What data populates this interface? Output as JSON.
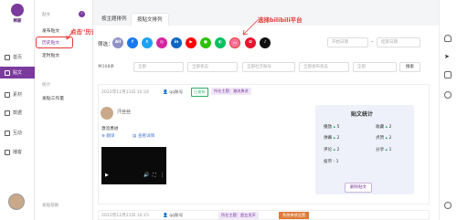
{
  "brand": {
    "name": "稀薪"
  },
  "nav": [
    {
      "label": "首页"
    },
    {
      "label": "贴文"
    },
    {
      "label": "素材"
    },
    {
      "label": "数据"
    },
    {
      "label": "互动"
    },
    {
      "label": "播客"
    }
  ],
  "sub_nav": {
    "section1": "贴文",
    "items1": [
      "发布贴文",
      "历史贴文",
      "定时贴文"
    ],
    "section2": "统计",
    "items2": [
      "发贴工作量"
    ],
    "help": "发贴帮助"
  },
  "annotations": {
    "history": "点击\"历史贴文\"",
    "bilibili": "选择bilibili平台"
  },
  "tabs": [
    "按主题排列",
    "按贴文排列"
  ],
  "filter": {
    "label": "筛选：",
    "all": "All"
  },
  "platform_icons": [
    "facebook-icon",
    "twitter-icon",
    "instagram-icon",
    "youtube-icon",
    "wechat-icon",
    "bilibili-icon",
    "weibo-icon",
    "tiktok-icon"
  ],
  "dates": {
    "start": "开始日期",
    "end": "结束日期"
  },
  "query": {
    "total": "共108条",
    "selects": [
      "全部",
      "全部状态",
      "全部社交账号",
      "全部发布状态",
      "全部"
    ],
    "search_placeholder": "",
    "search_button": "搜索"
  },
  "post": {
    "time": "2022年12月21日 10:34",
    "account": "qq账号",
    "status": "已发布",
    "topic": "所在主题：激流勇进",
    "author": "汗丝丝",
    "text": "激流勇进",
    "translate": "翻译",
    "details": "查看详情"
  },
  "stats": {
    "title": "贴文统计",
    "rows": [
      {
        "k1": "播放",
        "v1": "5",
        "k2": "收藏",
        "v2": "2"
      },
      {
        "k1": "弹幕",
        "v1": "2",
        "k2": "点赞",
        "v2": "2"
      },
      {
        "k1": "评论",
        "v1": "2",
        "k2": "分享",
        "v2": "1"
      },
      {
        "k1": "投币",
        "v1": "1",
        "k2": "",
        "v2": ""
      }
    ],
    "delete": "删除贴文"
  },
  "post2": {
    "time": "2022年12月21日 10:15",
    "account": "qq账号",
    "topic": "所在主题：超五发声",
    "tag": "系统审核设置"
  },
  "colors": {
    "accent": "#7b3a9e",
    "annotation": "#e53935"
  }
}
